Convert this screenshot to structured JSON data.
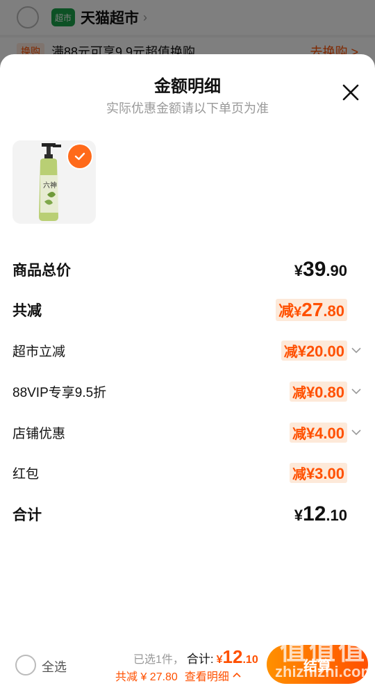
{
  "background": {
    "shop_logo_text": "超市",
    "shop_name": "天猫超市",
    "promo_tag": "换购",
    "promo_text": "满88元可享9.9元超值换购",
    "promo_link": "去换购 >"
  },
  "sheet": {
    "title": "金额明细",
    "subtitle": "实际优惠金额请以下单页为准"
  },
  "rows": {
    "goods_total": {
      "label": "商品总价",
      "yen": "¥",
      "int": "39",
      "dec": ".90"
    },
    "total_discount": {
      "label": "共减",
      "prefix": "减",
      "yen": "¥",
      "int": "27",
      "dec": ".80"
    },
    "supermarket_discount": {
      "label": "超市立减",
      "prefix": "减",
      "value": "¥20.00"
    },
    "vip_discount": {
      "label": "88VIP专享9.5折",
      "prefix": "减",
      "value": "¥0.80"
    },
    "store_discount": {
      "label": "店铺优惠",
      "prefix": "减",
      "value": "¥4.00"
    },
    "red_packet": {
      "label": "红包",
      "prefix": "减",
      "value": "¥3.00"
    },
    "sum": {
      "label": "合计",
      "yen": "¥",
      "int": "12",
      "dec": ".10"
    }
  },
  "bottom_bar": {
    "select_all": "全选",
    "selected_count": "已选1件，",
    "total_label": "合计:",
    "total_yen": "¥",
    "total_int": "12",
    "total_dec": ".10",
    "saved_text": "共减 ¥ 27.80",
    "detail_link": "查看明细",
    "checkout_label": "结算"
  },
  "watermark": {
    "top": "值值值",
    "bottom": "zhizhizhi.com"
  },
  "colors": {
    "accent": "#ff5000",
    "accent_gradient_start": "#ff9000"
  }
}
